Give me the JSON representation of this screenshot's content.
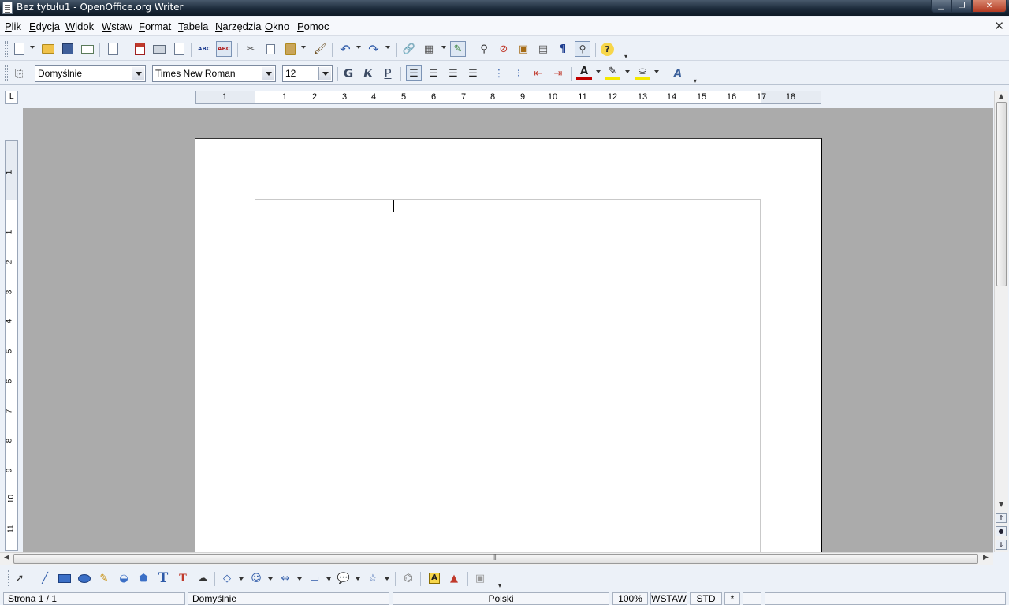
{
  "window": {
    "title": "Bez tytułu1 - OpenOffice.org Writer",
    "minimize": "▁",
    "maximize": "❐",
    "close": "✕"
  },
  "menu": {
    "items": [
      {
        "label": "Plik",
        "accel": "P",
        "rest": "lik"
      },
      {
        "label": "Edycja",
        "accel": "E",
        "rest": "dycja"
      },
      {
        "label": "Widok",
        "accel": "W",
        "rest": "idok"
      },
      {
        "label": "Wstaw",
        "accel": "W",
        "rest": "staw"
      },
      {
        "label": "Format",
        "accel": "F",
        "rest": "ormat"
      },
      {
        "label": "Tabela",
        "accel": "T",
        "rest": "abela"
      },
      {
        "label": "Narzędzia",
        "accel": "N",
        "rest": "arzędzia"
      },
      {
        "label": "Okno",
        "accel": "O",
        "rest": "kno"
      },
      {
        "label": "Pomoc",
        "accel": "P",
        "rest": "omoc"
      }
    ],
    "doc_close": "✕"
  },
  "formatting": {
    "paragraph_style": "Domyślnie",
    "font_name": "Times New Roman",
    "font_size": "12",
    "bold_label": "G",
    "italic_label": "K",
    "underline_label": "P"
  },
  "icons": {
    "find": "🔍",
    "help": "?",
    "nonprinting": "¶",
    "spell_abc": "ABC"
  },
  "ruler": {
    "corner": "L",
    "h_numbers": [
      "1",
      "1",
      "2",
      "3",
      "4",
      "5",
      "6",
      "7",
      "8",
      "9",
      "10",
      "11",
      "12",
      "13",
      "14",
      "15",
      "16",
      "17",
      "18"
    ],
    "v_numbers": [
      "1",
      "1",
      "2",
      "3",
      "4",
      "5",
      "6",
      "7",
      "8",
      "9",
      "10",
      "11"
    ]
  },
  "status": {
    "page": "Strona  1 / 1",
    "style": "Domyślnie",
    "language": "Polski",
    "zoom": "100%",
    "insert_mode": "WSTAW",
    "selection_mode": "STD",
    "modified": "*"
  }
}
